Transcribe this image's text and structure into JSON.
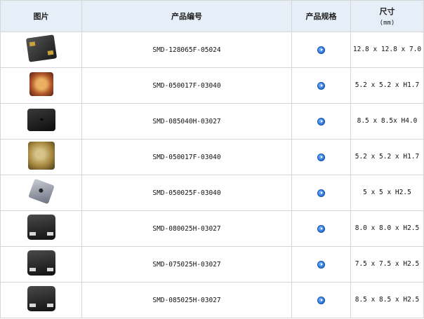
{
  "headers": {
    "image": "图片",
    "code": "产品编号",
    "spec": "产品规格",
    "size": "尺寸",
    "size_unit": "(mm)"
  },
  "rows": [
    {
      "thumb": "black-square-buzzer-gold-pins",
      "code": "SMD-128065F-05024",
      "size": "12.8 x 12.8 x 7.0"
    },
    {
      "thumb": "copper-round-buzzer",
      "code": "SMD-050017F-03040",
      "size": "5.2 x 5.2 x H1.7"
    },
    {
      "thumb": "black-square-buzzer",
      "code": "SMD-085040H-03027",
      "size": "8.5 x 8.5x H4.0"
    },
    {
      "thumb": "gold-round-buzzer",
      "code": "SMD-050017F-03040",
      "size": "5.2 x 5.2 x H1.7"
    },
    {
      "thumb": "grey-small-buzzer",
      "code": "SMD-050025F-03040",
      "size": "5 x 5 x H2.5"
    },
    {
      "thumb": "black-smd-buzzer",
      "code": "SMD-080025H-03027",
      "size": "8.0 x 8.0 x H2.5"
    },
    {
      "thumb": "black-smd-buzzer",
      "code": "SMD-075025H-03027",
      "size": "7.5 x 7.5 x H2.5"
    },
    {
      "thumb": "black-smd-buzzer",
      "code": "SMD-085025H-03027",
      "size": "8.5 x 8.5 x H2.5"
    }
  ],
  "icons": {
    "spec_button": "play-circle-icon"
  },
  "colors": {
    "header_bg": "#e6eef8",
    "border": "#d6d6d6",
    "spec_button": "#1460c8"
  }
}
